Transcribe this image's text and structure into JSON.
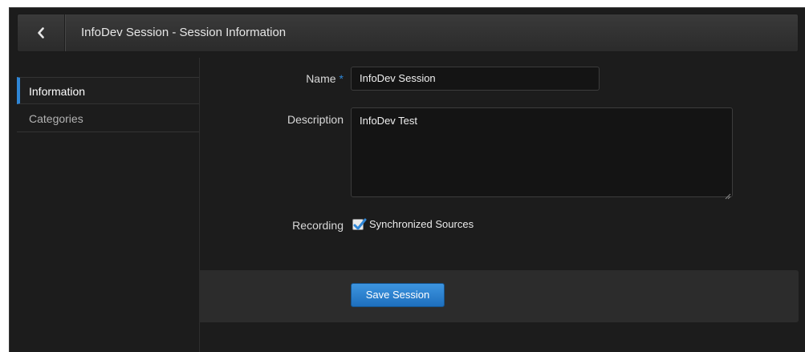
{
  "header": {
    "title": "InfoDev Session - Session Information",
    "back_icon": "chevron-left-icon"
  },
  "sidebar": {
    "items": [
      {
        "label": "Information",
        "active": true
      },
      {
        "label": "Categories",
        "active": false
      }
    ]
  },
  "form": {
    "name_label": "Name",
    "required_marker": "*",
    "name_value": "InfoDev Session",
    "description_label": "Description",
    "description_value": "InfoDev Test",
    "recording_label": "Recording",
    "recording_option_label": "Synchronized Sources",
    "recording_checked": true
  },
  "actions": {
    "save_label": "Save Session"
  },
  "colors": {
    "accent": "#2f86d6",
    "background": "#1c1c1c",
    "header": "#333333"
  }
}
